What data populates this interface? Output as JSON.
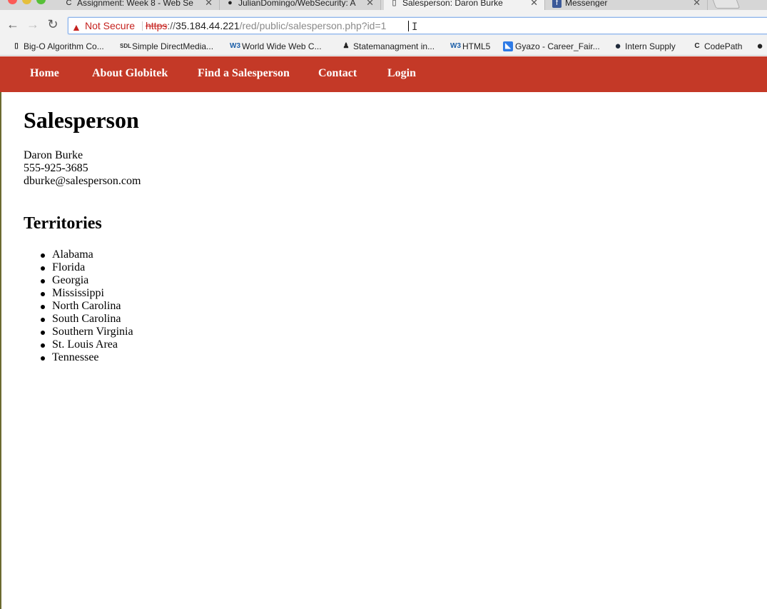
{
  "browser": {
    "tabs": [
      {
        "title": "Assignment: Week 8 - Web Se",
        "icon": "codepath-icon",
        "active": false
      },
      {
        "title": "JulianDomingo/WebSecurity: A",
        "icon": "github-icon",
        "active": false
      },
      {
        "title": "Salesperson: Daron Burke",
        "icon": "page-icon",
        "active": true
      },
      {
        "title": "Messenger",
        "icon": "facebook-icon",
        "active": false
      }
    ],
    "security_label": "Not Secure",
    "url_scheme": "https",
    "url_sep": "://",
    "url_host": "35.184.44.221",
    "url_path": "/red/public/salesperson.php?id=1",
    "bookmarks": [
      {
        "label": "Big-O Algorithm Co...",
        "icon": "page-icon"
      },
      {
        "label": "Simple DirectMedia...",
        "icon": "sdl-icon"
      },
      {
        "label": "World Wide Web C...",
        "icon": "w3-icon"
      },
      {
        "label": "Statemanagment in...",
        "icon": "person-icon"
      },
      {
        "label": "HTML5",
        "icon": "w3-icon"
      },
      {
        "label": "Gyazo - Career_Fair...",
        "icon": "gyazo-icon"
      },
      {
        "label": "Intern Supply",
        "icon": "circle-icon"
      },
      {
        "label": "CodePath",
        "icon": "codepath-icon"
      }
    ]
  },
  "site_nav": [
    "Home",
    "About Globitek",
    "Find a Salesperson",
    "Contact",
    "Login"
  ],
  "page": {
    "title": "Salesperson",
    "name": "Daron Burke",
    "phone": "555-925-3685",
    "email": "dburke@salesperson.com",
    "territories_title": "Territories",
    "territories": [
      "Alabama",
      "Florida",
      "Georgia",
      "Mississippi",
      "North Carolina",
      "South Carolina",
      "Southern Virginia",
      "St. Louis Area",
      "Tennessee"
    ]
  },
  "colors": {
    "nav_background": "#c43927",
    "not_secure": "#c5221f"
  }
}
